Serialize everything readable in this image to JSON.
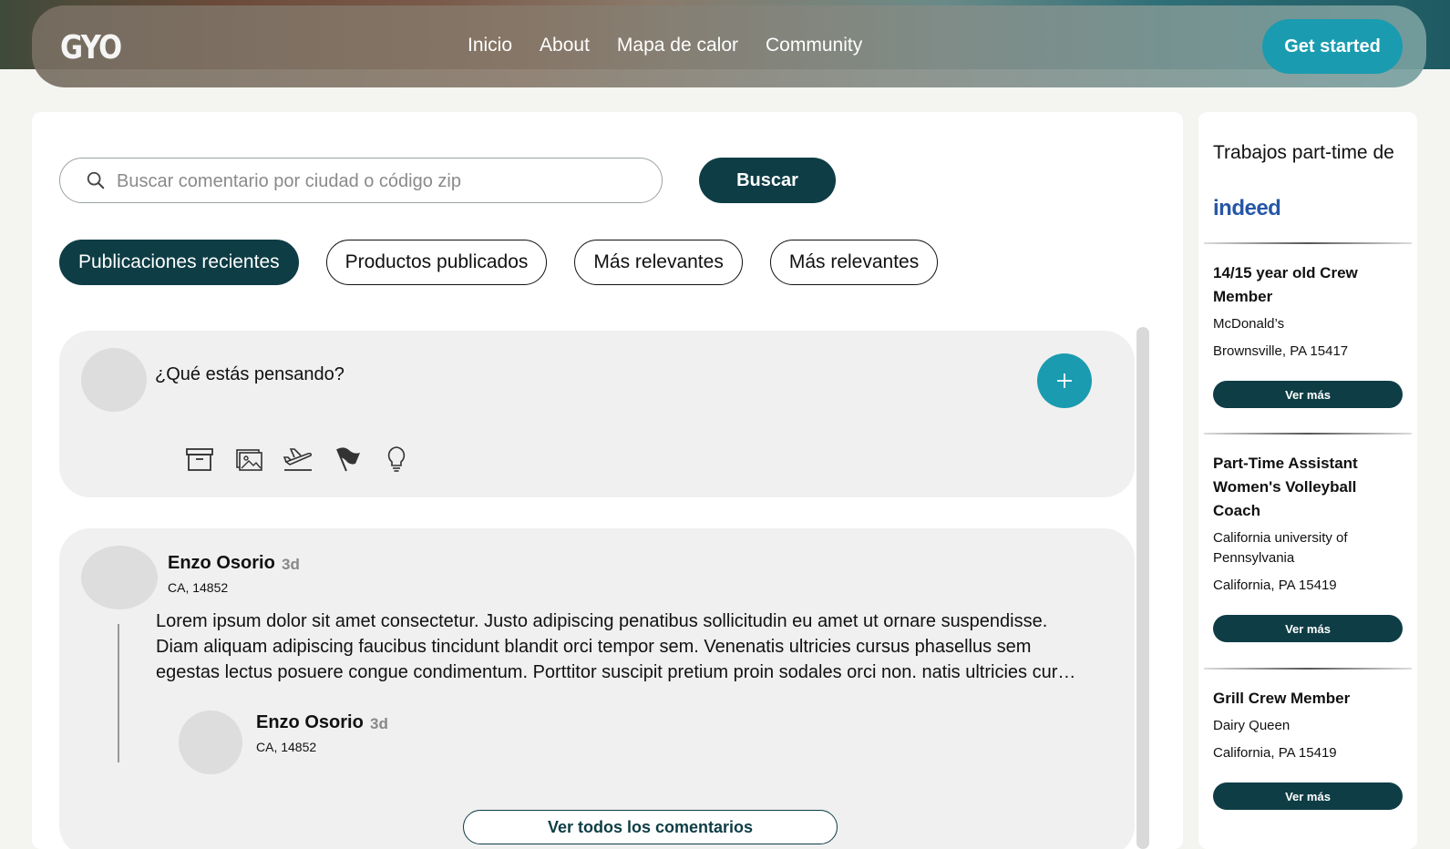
{
  "header": {
    "logo": "GYO",
    "nav": [
      "Inicio",
      "About",
      "Mapa de calor",
      "Community"
    ],
    "cta": "Get started"
  },
  "search": {
    "placeholder": "Buscar comentario por ciudad o código zip",
    "button": "Buscar"
  },
  "filters": [
    {
      "label": "Publicaciones recientes",
      "active": true
    },
    {
      "label": "Productos publicados",
      "active": false
    },
    {
      "label": "Más relevantes",
      "active": false
    },
    {
      "label": "Más relevantes",
      "active": false
    }
  ],
  "composer": {
    "prompt": "¿Qué estás pensando?",
    "tools": [
      "archive-icon",
      "image-icon",
      "plane-icon",
      "flag-icon",
      "lightbulb-icon"
    ]
  },
  "post": {
    "author": "Enzo Osorio",
    "time": "3d",
    "location": "CA, 14852",
    "body": "Lorem ipsum dolor sit amet consectetur. Justo adipiscing penatibus sollicitudin eu amet ut ornare suspendisse. Diam aliquam adipiscing faucibus tincidunt blandit orci tempor sem. Venenatis ultricies cursus phasellus sem egestas lectus posuere congue condimentum. Porttitor suscipit pretium proin sodales orci non. natis ultricies cur…",
    "reply": {
      "author": "Enzo Osorio",
      "time": "3d",
      "location": "CA, 14852"
    },
    "view_all": "Ver todos los comentarios"
  },
  "sidebar": {
    "title": "Trabajos part-time de",
    "brand": "indeed",
    "jobs": [
      {
        "title": "14/15 year old Crew Member",
        "company": "McDonald’s",
        "location": "Brownsville, PA 15417",
        "button": "Ver más"
      },
      {
        "title": "Part-Time Assistant Women's Volleyball Coach",
        "company": "California university of Pennsylvania",
        "location": "California, PA 15419",
        "button": "Ver más"
      },
      {
        "title": "Grill Crew Member",
        "company": "Dairy Queen",
        "location": "California, PA 15419",
        "button": "Ver más"
      }
    ]
  },
  "colors": {
    "accent": "#1a9bb0",
    "dark": "#0e3d45",
    "card": "#f0f0f0"
  }
}
